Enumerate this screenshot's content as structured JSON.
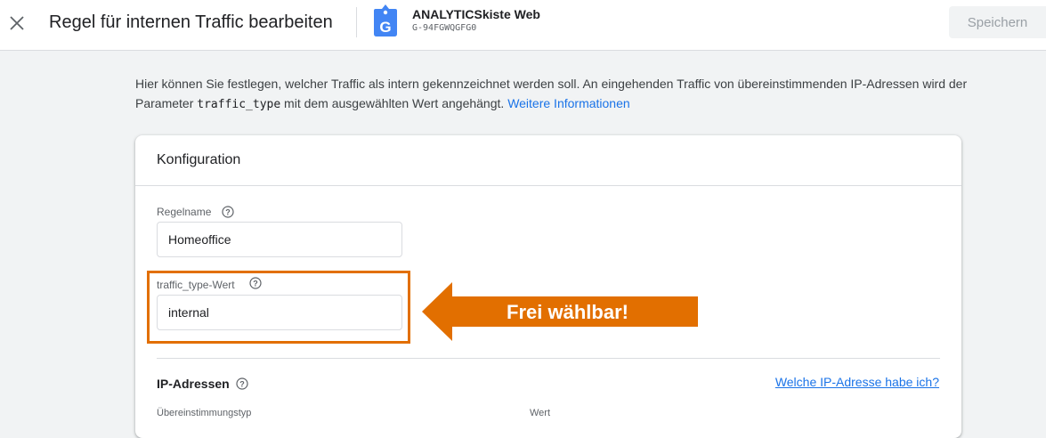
{
  "header": {
    "title": "Regel für internen Traffic bearbeiten",
    "property_name": "ANALYTICSkiste Web",
    "property_id": "G-94FGWQGFG0",
    "save_label": "Speichern",
    "badge_letter": "G"
  },
  "intro": {
    "text_before": "Hier können Sie festlegen, welcher Traffic als intern gekennzeichnet werden soll. An eingehenden Traffic von übereinstimmenden IP-Adressen wird der Parameter ",
    "param": "traffic_type",
    "text_after": " mit dem ausgewählten Wert angehängt. ",
    "link": "Weitere Informationen"
  },
  "card": {
    "title": "Konfiguration",
    "rule_name_label": "Regelname",
    "rule_name_value": "Homeoffice",
    "traffic_type_label": "traffic_type-Wert",
    "traffic_type_value": "internal",
    "ip_section_title": "IP-Adressen",
    "ip_link": "Welche IP-Adresse habe ich?",
    "col_match_type": "Übereinstimmungstyp",
    "col_value": "Wert"
  },
  "annotation": {
    "arrow_text": "Frei wählbar!",
    "color": "#e26f00"
  },
  "colors": {
    "link": "#1a73e8",
    "badge": "#4285f4"
  },
  "icons": [
    "close-icon",
    "google-analytics-badge-icon",
    "help-icon"
  ]
}
